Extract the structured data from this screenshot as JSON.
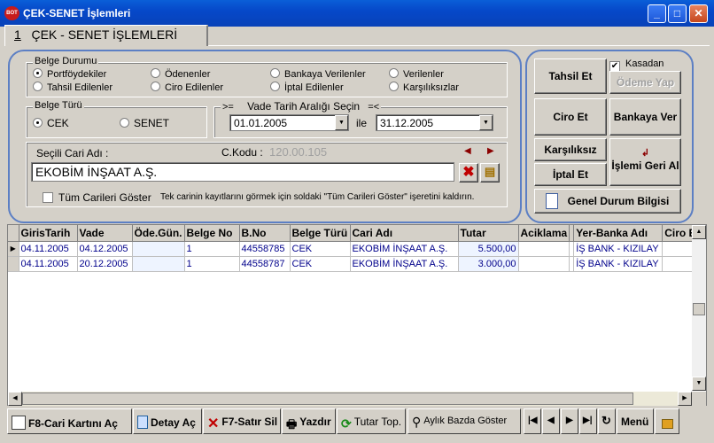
{
  "window": {
    "title": "ÇEK-SENET İşlemleri",
    "app_icon_text": "BOT"
  },
  "tab": {
    "number": "1",
    "label": "ÇEK - SENET İŞLEMLERİ"
  },
  "belge_durumu": {
    "legend": "Belge Durumu",
    "options": [
      "Portföydekiler",
      "Ödenenler",
      "Bankaya Verilenler",
      "Verilenler",
      "Tahsil Edilenler",
      "Ciro Edilenler",
      "İptal Edilenler",
      "Karşılıksızlar"
    ],
    "selected": "Portföydekiler"
  },
  "belge_turu": {
    "legend": "Belge Türü",
    "options": [
      "CEK",
      "SENET"
    ],
    "selected": "CEK"
  },
  "vade": {
    "legend_prefix": ">=",
    "legend": "Vade Tarih Aralığı Seçin",
    "legend_suffix": "=<",
    "start": "01.01.2005",
    "separator": "ile",
    "end": "31.12.2005"
  },
  "cari": {
    "label": "Seçili Cari Adı :",
    "code_label": "C.Kodu :",
    "code_value": "120.00.105",
    "name_value": "EKOBİM İNŞAAT A.Ş.",
    "all_label": "Tüm Carileri Göster",
    "all_checked": false,
    "hint": "Tek carinin kayıtlarını görmek için soldaki \"Tüm Carileri Göster\" işeretini kaldırın."
  },
  "actions": {
    "tahsil_et": "Tahsil Et",
    "kasadan": "Kasadan",
    "kasadan_checked": true,
    "odeme_yap": "Ödeme Yap",
    "ciro_et": "Ciro Et",
    "bankaya_ver": "Bankaya Ver",
    "karsiliksiz": "Karşılıksız",
    "iptal_et": "İptal Et",
    "islemi_geri_al": "İşlemi Geri Al",
    "genel_durum": "Genel Durum Bilgisi"
  },
  "grid": {
    "columns": [
      "GirisTarih",
      "Vade",
      "Öde.Gün.",
      "Belge No",
      "B.No",
      "Belge Türü",
      "Cari Adı",
      "Tutar",
      "Aciklama",
      "",
      "Yer-Banka Adı",
      "Ciro E"
    ],
    "rows": [
      [
        "04.11.2005",
        "04.12.2005",
        "",
        "1",
        "44558785",
        "CEK",
        "EKOBİM İNŞAAT A.Ş.",
        "5.500,00",
        "",
        "",
        "İŞ BANK - KIZILAY",
        ""
      ],
      [
        "04.11.2005",
        "20.12.2005",
        "",
        "1",
        "44558787",
        "CEK",
        "EKOBİM İNŞAAT A.Ş.",
        "3.000,00",
        "",
        "",
        "İŞ BANK - KIZILAY",
        ""
      ]
    ]
  },
  "toolbar": {
    "cari_karti": "F8-Cari Kartını Aç",
    "detay": "Detay Aç",
    "satir_sil": "F7-Satır Sil",
    "yazdir": "Yazdır",
    "tutar_top": "Tutar Top.",
    "aylik": "Aylık Bazda Göster",
    "menu": "Menü"
  }
}
